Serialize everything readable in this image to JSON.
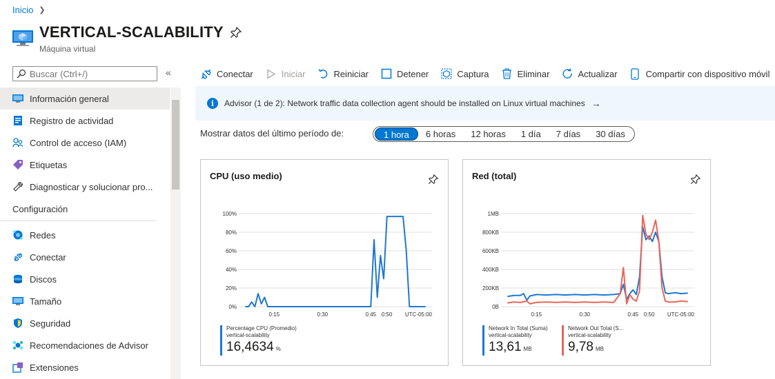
{
  "breadcrumb": {
    "home": "Inicio"
  },
  "resource": {
    "title": "VERTICAL-SCALABILITY",
    "subtitle": "Máquina virtual"
  },
  "search": {
    "placeholder": "Buscar (Ctrl+/)"
  },
  "sidebar": {
    "items_top": [
      {
        "label": "Información general",
        "icon": "overview-icon",
        "active": true
      },
      {
        "label": "Registro de actividad",
        "icon": "activity-log-icon"
      },
      {
        "label": "Control de acceso (IAM)",
        "icon": "iam-icon"
      },
      {
        "label": "Etiquetas",
        "icon": "tag-icon"
      },
      {
        "label": "Diagnosticar y solucionar pro...",
        "icon": "wrench-icon"
      }
    ],
    "section": "Configuración",
    "items_config": [
      {
        "label": "Redes",
        "icon": "networking-icon"
      },
      {
        "label": "Conectar",
        "icon": "connect-icon"
      },
      {
        "label": "Discos",
        "icon": "disks-icon"
      },
      {
        "label": "Tamaño",
        "icon": "size-icon"
      },
      {
        "label": "Seguridad",
        "icon": "security-shield-icon"
      },
      {
        "label": "Recomendaciones de Advisor",
        "icon": "advisor-icon"
      },
      {
        "label": "Extensiones",
        "icon": "extensions-icon"
      }
    ]
  },
  "toolbar": {
    "connect": "Conectar",
    "start": "Iniciar",
    "restart": "Reiniciar",
    "stop": "Detener",
    "capture": "Captura",
    "delete": "Eliminar",
    "refresh": "Actualizar",
    "share": "Compartir con dispositivo móvil"
  },
  "advisor": {
    "text": "Advisor (1 de 2): Network traffic data collection agent should be installed on Linux virtual machines",
    "arrow": "→"
  },
  "period": {
    "label": "Mostrar datos del último período de:",
    "options": [
      "1 hora",
      "6 horas",
      "12 horas",
      "1 día",
      "7 días",
      "30 días"
    ],
    "selected": "1 hora"
  },
  "colors": {
    "accent": "#0078d4",
    "series_in": "#1f77d0",
    "series_out": "#e8655a"
  },
  "chart_data": [
    {
      "type": "line",
      "title": "CPU (uso medio)",
      "ylim": [
        0,
        100
      ],
      "y_ticks": [
        "0%",
        "20%",
        "40%",
        "60%",
        "80%",
        "100%"
      ],
      "y_tick_values": [
        0,
        20,
        40,
        60,
        80,
        100
      ],
      "x_tick_labels": [
        "0:15",
        "0:30",
        "0:45",
        "0:50"
      ],
      "x_tick_values": [
        15,
        30,
        45,
        50
      ],
      "x_range": [
        4,
        64
      ],
      "timezone_label": "UTC-05:00",
      "series": [
        {
          "name": "Percentage CPU (Promedio)",
          "resource": "vertical-scalability",
          "summary_value": "16,4634",
          "summary_unit": "%",
          "color": "#1f77d0",
          "x": [
            6,
            7,
            8,
            9,
            10,
            11,
            12,
            13,
            14,
            15,
            38,
            44,
            45,
            46,
            47,
            48,
            49,
            50,
            51,
            52,
            53,
            54,
            55,
            56,
            57,
            58,
            62
          ],
          "values": [
            0,
            0,
            5,
            0,
            14,
            3,
            10,
            0,
            0,
            0,
            0,
            0,
            0,
            72,
            10,
            55,
            30,
            97,
            97,
            97,
            97,
            97,
            97,
            60,
            0,
            0,
            0
          ]
        }
      ]
    },
    {
      "type": "line",
      "title": "Red (total)",
      "ylim": [
        0,
        1000
      ],
      "y_ticks": [
        "0B",
        "200KB",
        "400KB",
        "600KB",
        "800KB",
        "1MB"
      ],
      "y_tick_values": [
        0,
        200,
        400,
        600,
        800,
        1000
      ],
      "x_tick_labels": [
        "0:15",
        "0:30",
        "0:45",
        "0:50"
      ],
      "x_tick_values": [
        15,
        30,
        45,
        50
      ],
      "x_range": [
        4,
        64
      ],
      "timezone_label": "UTC-05:00",
      "series": [
        {
          "name": "Network In Total (Suma)",
          "resource": "vertical-scalability",
          "summary_value": "13,61",
          "summary_unit": "MB",
          "color": "#1f77d0",
          "x": [
            6,
            8,
            10,
            11,
            12,
            13,
            15,
            18,
            21,
            24,
            27,
            30,
            33,
            36,
            39,
            41,
            42,
            43,
            44,
            45,
            46,
            47,
            48,
            49,
            50,
            51,
            52,
            53,
            54,
            55,
            56,
            58,
            60,
            62
          ],
          "values": [
            110,
            120,
            120,
            140,
            70,
            115,
            130,
            125,
            130,
            125,
            130,
            125,
            130,
            125,
            130,
            140,
            240,
            80,
            140,
            180,
            130,
            320,
            860,
            720,
            760,
            700,
            800,
            700,
            320,
            150,
            140,
            150,
            140,
            145
          ]
        },
        {
          "name": "Network Out Total (S...",
          "resource": "vertical-scalability",
          "summary_value": "9,78",
          "summary_unit": "MB",
          "color": "#e8655a",
          "x": [
            6,
            8,
            10,
            12,
            13,
            15,
            18,
            21,
            24,
            27,
            30,
            33,
            36,
            39,
            41,
            42,
            43,
            44,
            45,
            46,
            47,
            48,
            49,
            50,
            51,
            52,
            53,
            54,
            55,
            56,
            58,
            60,
            62
          ],
          "values": [
            40,
            50,
            45,
            60,
            30,
            45,
            50,
            45,
            50,
            45,
            50,
            45,
            50,
            45,
            140,
            420,
            30,
            130,
            80,
            60,
            170,
            980,
            780,
            720,
            800,
            930,
            700,
            200,
            60,
            50,
            50,
            60,
            55
          ]
        }
      ]
    }
  ]
}
